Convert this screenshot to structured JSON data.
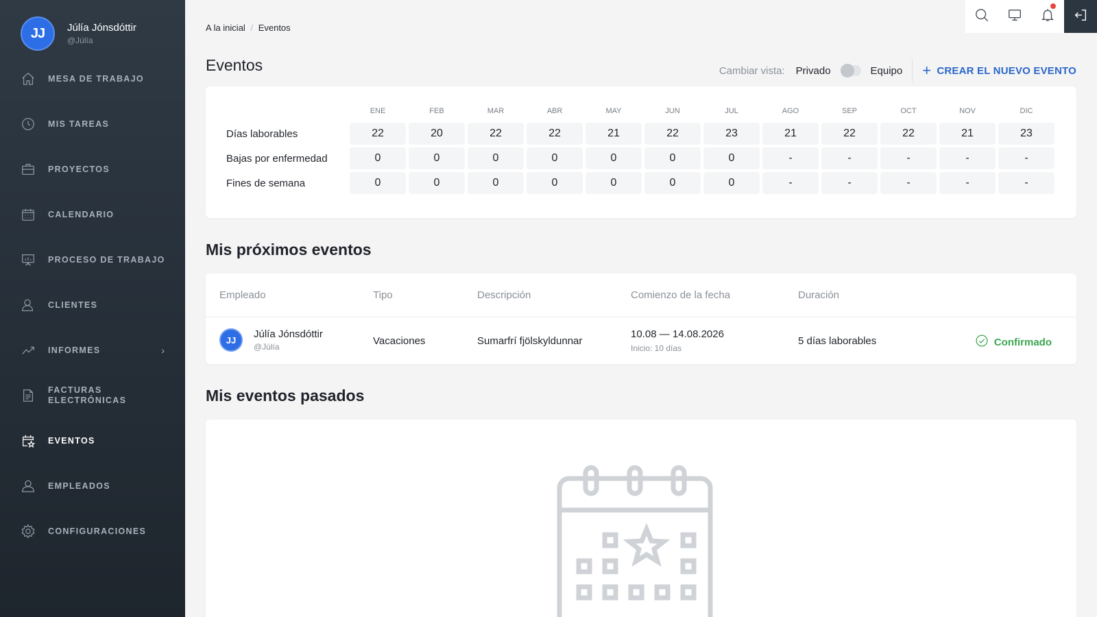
{
  "user": {
    "initials": "JJ",
    "name": "Júlía Jónsdóttir",
    "handle": "@Júlía"
  },
  "nav": [
    {
      "label": "MESA DE TRABAJO",
      "icon": "home-icon"
    },
    {
      "label": "MIS TAREAS",
      "icon": "clock-icon"
    },
    {
      "label": "PROYECTOS",
      "icon": "briefcase-icon"
    },
    {
      "label": "CALENDARIO",
      "icon": "calendar-icon"
    },
    {
      "label": "PROCESO DE TRABAJO",
      "icon": "presentation-icon"
    },
    {
      "label": "CLIENTES",
      "icon": "user-icon"
    },
    {
      "label": "INFORMES",
      "icon": "trend-icon"
    },
    {
      "label": "FACTURAS ELECTRÓNICAS",
      "icon": "document-icon"
    },
    {
      "label": "EVENTOS",
      "icon": "calendar-star-icon",
      "active": true
    },
    {
      "label": "EMPLEADOS",
      "icon": "users-icon"
    },
    {
      "label": "CONFIGURACIONES",
      "icon": "gear-icon"
    }
  ],
  "breadcrumb": {
    "home": "A la inicial",
    "sep": "/",
    "current": "Eventos"
  },
  "page": {
    "title": "Eventos"
  },
  "view_switch": {
    "label": "Cambiar vista:",
    "option_left": "Privado",
    "option_right": "Equipo",
    "state": "Privado"
  },
  "create_button": {
    "plus": "+",
    "label": "CREAR EL NUEVO EVENTO"
  },
  "summary": {
    "months": [
      "ENE",
      "FEB",
      "MAR",
      "ABR",
      "MAY",
      "JUN",
      "JUL",
      "AGO",
      "SEP",
      "OCT",
      "NOV",
      "DIC"
    ],
    "rows": [
      {
        "label": "Días laborables",
        "values": [
          "22",
          "20",
          "22",
          "22",
          "21",
          "22",
          "23",
          "21",
          "22",
          "22",
          "21",
          "23"
        ]
      },
      {
        "label": "Bajas por enfermedad",
        "values": [
          "0",
          "0",
          "0",
          "0",
          "0",
          "0",
          "0",
          "-",
          "-",
          "-",
          "-",
          "-"
        ]
      },
      {
        "label": "Fines de semana",
        "values": [
          "0",
          "0",
          "0",
          "0",
          "0",
          "0",
          "0",
          "-",
          "-",
          "-",
          "-",
          "-"
        ]
      }
    ]
  },
  "upcoming": {
    "title": "Mis próximos eventos",
    "headers": {
      "employee": "Empleado",
      "type": "Tipo",
      "description": "Descripción",
      "start": "Comienzo de la fecha",
      "duration": "Duración"
    },
    "rows": [
      {
        "initials": "JJ",
        "name": "Júlía Jónsdóttir",
        "handle": "@Júlía",
        "type": "Vacaciones",
        "description": "Sumarfrí fjölskyldunnar",
        "dates": "10.08 — 14.08.2026",
        "start_note": "Inicio: 10 días",
        "duration": "5 días laborables",
        "status": "Confirmado"
      }
    ]
  },
  "past": {
    "title": "Mis eventos pasados"
  },
  "colors": {
    "accent": "#2a66c9",
    "success": "#3aa651",
    "sidebar": "#2f3a45",
    "notification": "#e5483a"
  }
}
